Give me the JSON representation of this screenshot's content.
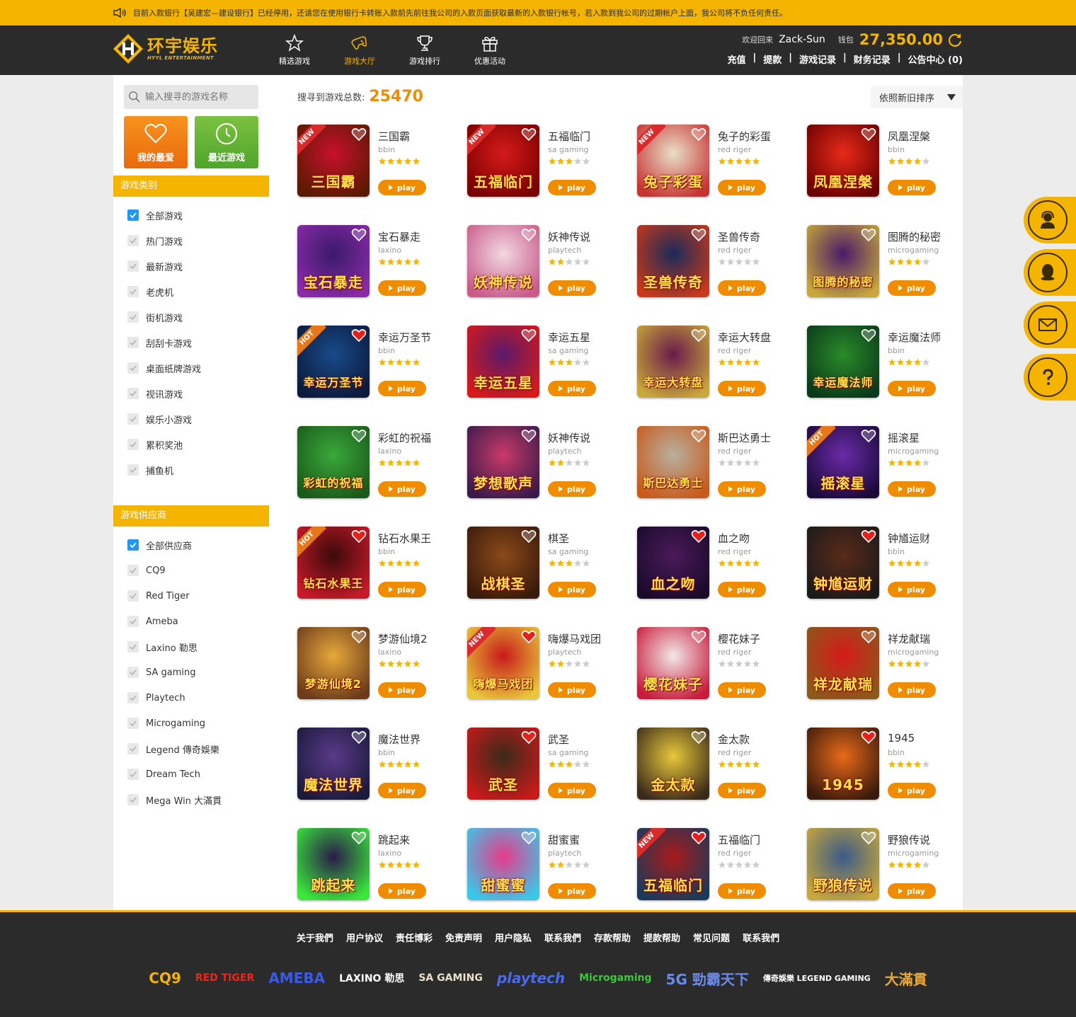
{
  "notice": {
    "text": "目前入款银行【吴建宏—建设银行】已经停用，还请您在使用银行卡转账入款前先前往我公司的入款页面获取最新的入款银行帐号，若入款到我公司的过期帐户上面，我公司将不负任何责任。"
  },
  "brand": {
    "cn": "环宇娱乐",
    "en": "HYYL ENTERTAINMENT"
  },
  "nav": [
    {
      "label": "精选游戏",
      "icon": "star-outline-icon",
      "active": false
    },
    {
      "label": "游戏大厅",
      "icon": "gamepad-icon",
      "active": true
    },
    {
      "label": "游戏排行",
      "icon": "trophy-icon",
      "active": false
    },
    {
      "label": "优惠活动",
      "icon": "gift-icon",
      "active": false
    }
  ],
  "user": {
    "welcome": "欢迎回来",
    "name": "Zack-Sun",
    "wallet_label": "钱包",
    "balance": "27,350.00",
    "links": [
      "充值",
      "提款",
      "游戏记录",
      "财务记录",
      "公告中心 (0)"
    ]
  },
  "sidebar": {
    "search_placeholder": "输入搜寻的游戏名称",
    "fav_label": "我的最爱",
    "recent_label": "最近游戏",
    "cat_title": "游戏类别",
    "categories": [
      {
        "label": "全部游戏",
        "checked": true
      },
      {
        "label": "热门游戏",
        "checked": false
      },
      {
        "label": "最新游戏",
        "checked": false
      },
      {
        "label": "老虎机",
        "checked": false
      },
      {
        "label": "街机游戏",
        "checked": false
      },
      {
        "label": "刮刮卡游戏",
        "checked": false
      },
      {
        "label": "桌面纸牌游戏",
        "checked": false
      },
      {
        "label": "视讯游戏",
        "checked": false
      },
      {
        "label": "娱乐小游戏",
        "checked": false
      },
      {
        "label": "累积奖池",
        "checked": false
      },
      {
        "label": "捕鱼机",
        "checked": false
      }
    ],
    "prov_title": "游戏供应商",
    "providers": [
      {
        "label": "全部供应商",
        "checked": true
      },
      {
        "label": "CQ9",
        "checked": false
      },
      {
        "label": "Red Tiger",
        "checked": false
      },
      {
        "label": "Ameba",
        "checked": false
      },
      {
        "label": "Laxino 勒思",
        "checked": false
      },
      {
        "label": "SA gaming",
        "checked": false
      },
      {
        "label": "Playtech",
        "checked": false
      },
      {
        "label": "Microgaming",
        "checked": false
      },
      {
        "label": "Legend 傳奇娛樂",
        "checked": false
      },
      {
        "label": "Dream Tech",
        "checked": false
      },
      {
        "label": "Mega Win 大滿貫",
        "checked": false
      }
    ]
  },
  "content": {
    "count_label": "搜寻到游戏总数:",
    "count": "25470",
    "sort_label": "依照新旧排序",
    "play_label": "play"
  },
  "games": [
    {
      "name": "三国霸",
      "provider": "bbin",
      "rating": 5,
      "badge": "NEW",
      "fav": false,
      "art": "三国霸",
      "colors": [
        "#c8102e",
        "#5a1a00"
      ]
    },
    {
      "name": "五福临门",
      "provider": "sa gaming",
      "rating": 3,
      "badge": "NEW",
      "fav": false,
      "art": "五福临门",
      "colors": [
        "#d61a1a",
        "#7a0000"
      ]
    },
    {
      "name": "兔子的彩蛋",
      "provider": "red riger",
      "rating": 5,
      "badge": "NEW",
      "fav": false,
      "art": "兔子彩蛋",
      "colors": [
        "#e8e0c8",
        "#c83232"
      ]
    },
    {
      "name": "凤凰涅槃",
      "provider": "bbin",
      "rating": 4,
      "badge": "",
      "fav": false,
      "art": "凤凰涅槃",
      "colors": [
        "#e82a1a",
        "#6a0000"
      ]
    },
    {
      "name": "宝石暴走",
      "provider": "laxino",
      "rating": 5,
      "badge": "",
      "fav": false,
      "art": "宝石暴走",
      "colors": [
        "#3a1a6a",
        "#8a2aa8"
      ]
    },
    {
      "name": "妖神传说",
      "provider": "playtech",
      "rating": 2,
      "badge": "",
      "fav": false,
      "art": "妖神传说",
      "colors": [
        "#f2d8e0",
        "#c85a8a"
      ]
    },
    {
      "name": "圣兽传奇",
      "provider": "red riger",
      "rating": 0,
      "badge": "",
      "fav": false,
      "art": "圣兽传奇",
      "colors": [
        "#1a2a5a",
        "#c83a1a"
      ]
    },
    {
      "name": "图腾的秘密",
      "provider": "microgaming",
      "rating": 4,
      "badge": "",
      "fav": false,
      "art": "图腾的秘密",
      "colors": [
        "#4a1a6a",
        "#c8a83a"
      ]
    },
    {
      "name": "幸运万圣节",
      "provider": "bbin",
      "rating": 5,
      "badge": "HOT",
      "fav": true,
      "art": "幸运万圣节",
      "colors": [
        "#1a4a8a",
        "#0a1a3a"
      ]
    },
    {
      "name": "幸运五星",
      "provider": "sa gaming",
      "rating": 3,
      "badge": "",
      "fav": false,
      "art": "幸运五星",
      "colors": [
        "#5a1a6a",
        "#d61a1a"
      ]
    },
    {
      "name": "幸运大转盘",
      "provider": "red riger",
      "rating": 5,
      "badge": "",
      "fav": false,
      "art": "幸运大转盘",
      "colors": [
        "#6a1a4a",
        "#c8a83a"
      ]
    },
    {
      "name": "幸运魔法师",
      "provider": "bbin",
      "rating": 4,
      "badge": "",
      "fav": false,
      "art": "幸运魔法师",
      "colors": [
        "#2a8a2a",
        "#0a3a1a"
      ]
    },
    {
      "name": "彩虹的祝福",
      "provider": "laxino",
      "rating": 5,
      "badge": "",
      "fav": false,
      "art": "彩虹的祝福",
      "colors": [
        "#3aa83a",
        "#1a5a1a"
      ]
    },
    {
      "name": "妖神传说",
      "provider": "playtech",
      "rating": 2,
      "badge": "",
      "fav": false,
      "art": "梦想歌声",
      "colors": [
        "#c83a6a",
        "#3a1a4a"
      ]
    },
    {
      "name": "斯巴达勇士",
      "provider": "red riger",
      "rating": 0,
      "badge": "",
      "fav": false,
      "art": "斯巴达勇士",
      "colors": [
        "#b8b0a0",
        "#c85a1a"
      ]
    },
    {
      "name": "摇滚星",
      "provider": "microgaming",
      "rating": 4,
      "badge": "HOT",
      "fav": false,
      "art": "摇滚星",
      "colors": [
        "#6a2aa8",
        "#1a0a3a"
      ]
    },
    {
      "name": "钻石水果王",
      "provider": "bbin",
      "rating": 5,
      "badge": "HOT",
      "fav": true,
      "art": "钻石水果王",
      "colors": [
        "#3a0a0a",
        "#c81a2a"
      ]
    },
    {
      "name": "棋圣",
      "provider": "sa gaming",
      "rating": 3,
      "badge": "",
      "fav": false,
      "art": "战棋圣",
      "colors": [
        "#8a4a1a",
        "#3a1a0a"
      ]
    },
    {
      "name": "血之吻",
      "provider": "red riger",
      "rating": 5,
      "badge": "",
      "fav": true,
      "art": "血之吻",
      "colors": [
        "#4a1a5a",
        "#1a0a2a"
      ]
    },
    {
      "name": "钟馗运财",
      "provider": "bbin",
      "rating": 4,
      "badge": "",
      "fav": true,
      "art": "钟馗运财",
      "colors": [
        "#5a2a1a",
        "#1a1a1a"
      ]
    },
    {
      "name": "梦游仙境2",
      "provider": "laxino",
      "rating": 5,
      "badge": "",
      "fav": false,
      "art": "梦游仙境2",
      "colors": [
        "#e8a83a",
        "#6a3a1a"
      ]
    },
    {
      "name": "嗨爆马戏团",
      "provider": "playtech",
      "rating": 2,
      "badge": "NEW",
      "fav": true,
      "art": "嗨爆马戏团",
      "colors": [
        "#c81a1a",
        "#e8c83a"
      ]
    },
    {
      "name": "樱花妹子",
      "provider": "red riger",
      "rating": 0,
      "badge": "",
      "fav": false,
      "art": "樱花妹子",
      "colors": [
        "#f2e8e8",
        "#c81a3a"
      ]
    },
    {
      "name": "祥龙献瑞",
      "provider": "microgaming",
      "rating": 4,
      "badge": "",
      "fav": false,
      "art": "祥龙献瑞",
      "colors": [
        "#d61a1a",
        "#8a5a1a"
      ]
    },
    {
      "name": "魔法世界",
      "provider": "bbin",
      "rating": 5,
      "badge": "",
      "fav": false,
      "art": "魔法世界",
      "colors": [
        "#5a3a8a",
        "#1a1a3a"
      ]
    },
    {
      "name": "武圣",
      "provider": "sa gaming",
      "rating": 3,
      "badge": "",
      "fav": true,
      "art": "武圣",
      "colors": [
        "#3a2a1a",
        "#c81a1a"
      ]
    },
    {
      "name": "金太款",
      "provider": "red riger",
      "rating": 5,
      "badge": "",
      "fav": false,
      "art": "金太款",
      "colors": [
        "#e8c83a",
        "#3a2a1a"
      ]
    },
    {
      "name": "1945",
      "provider": "bbin",
      "rating": 4,
      "badge": "",
      "fav": true,
      "art": "1945",
      "colors": [
        "#e86a1a",
        "#3a1a0a"
      ]
    },
    {
      "name": "跳起来",
      "provider": "laxino",
      "rating": 5,
      "badge": "",
      "fav": false,
      "art": "跳起来",
      "colors": [
        "#2a1a4a",
        "#3ae83a"
      ]
    },
    {
      "name": "甜蜜蜜",
      "provider": "playtech",
      "rating": 2,
      "badge": "",
      "fav": false,
      "art": "甜蜜蜜",
      "colors": [
        "#e83a8a",
        "#3ac8e8"
      ]
    },
    {
      "name": "五福临门",
      "provider": "red riger",
      "rating": 0,
      "badge": "NEW",
      "fav": true,
      "art": "五福临门",
      "colors": [
        "#a81a1a",
        "#1a3a5a"
      ]
    },
    {
      "name": "野狼传说",
      "provider": "microgaming",
      "rating": 4,
      "badge": "",
      "fav": false,
      "art": "野狼传说",
      "colors": [
        "#3a5a8a",
        "#c8a83a"
      ]
    }
  ],
  "footer": {
    "links": [
      "关于我們",
      "用户协议",
      "责任博彩",
      "免责声明",
      "用户隐私",
      "联系我們",
      "存款帮助",
      "提款帮助",
      "常见问题",
      "联系我們"
    ],
    "partners": [
      {
        "name": "CQ9",
        "color": "#f4b400"
      },
      {
        "name": "RED TIGER",
        "color": "#e8281a"
      },
      {
        "name": "AMEBA",
        "color": "#3a5ae8"
      },
      {
        "name": "LAXINO 勒思",
        "color": "#ffffff"
      },
      {
        "name": "SA GAMING",
        "color": "#e8e0c8"
      },
      {
        "name": "playtech",
        "color": "#4a6ae8"
      },
      {
        "name": "Microgaming",
        "color": "#3ac83a"
      },
      {
        "name": "5G 勁霸天下",
        "color": "#6a8ae8"
      },
      {
        "name": "傳奇娛樂 LEGEND GAMING",
        "color": "#ffffff"
      },
      {
        "name": "大滿貫",
        "color": "#e8a83a"
      }
    ]
  },
  "colors": {
    "accent": "#f4b400",
    "play": "#f08c00",
    "header_bg": "#2b2b2b",
    "star": "#f4b400",
    "star_off": "#cccccc"
  }
}
